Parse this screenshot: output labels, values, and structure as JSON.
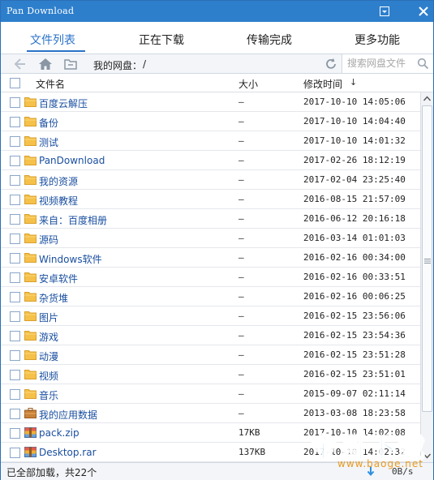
{
  "window": {
    "title": "Pan Download"
  },
  "tabs": [
    {
      "label": "文件列表",
      "active": true
    },
    {
      "label": "正在下载",
      "active": false
    },
    {
      "label": "传输完成",
      "active": false
    },
    {
      "label": "更多功能",
      "active": false
    }
  ],
  "toolbar": {
    "path_label": "我的网盘：",
    "path_value": "/",
    "search_placeholder": "搜索网盘文件"
  },
  "columns": {
    "name": "文件名",
    "size": "大小",
    "modified": "修改时间",
    "sort_indicator": "↓"
  },
  "files": [
    {
      "name": "百度云解压",
      "size": "–",
      "modified": "2017-10-10 14:05:06",
      "type": "folder"
    },
    {
      "name": "备份",
      "size": "–",
      "modified": "2017-10-10 14:04:40",
      "type": "folder"
    },
    {
      "name": "测试",
      "size": "–",
      "modified": "2017-10-10 14:01:32",
      "type": "folder"
    },
    {
      "name": "PanDownload",
      "size": "–",
      "modified": "2017-02-26 18:12:19",
      "type": "folder"
    },
    {
      "name": "我的资源",
      "size": "–",
      "modified": "2017-02-04 23:25:40",
      "type": "folder"
    },
    {
      "name": "视频教程",
      "size": "–",
      "modified": "2016-08-15 21:57:09",
      "type": "folder"
    },
    {
      "name": "来自：百度相册",
      "size": "–",
      "modified": "2016-06-12 20:16:18",
      "type": "folder"
    },
    {
      "name": "源码",
      "size": "–",
      "modified": "2016-03-14 01:01:03",
      "type": "folder"
    },
    {
      "name": "Windows软件",
      "size": "–",
      "modified": "2016-02-16 00:34:00",
      "type": "folder"
    },
    {
      "name": "安卓软件",
      "size": "–",
      "modified": "2016-02-16 00:33:51",
      "type": "folder"
    },
    {
      "name": "杂货堆",
      "size": "–",
      "modified": "2016-02-16 00:06:25",
      "type": "folder"
    },
    {
      "name": "图片",
      "size": "–",
      "modified": "2016-02-15 23:56:06",
      "type": "folder"
    },
    {
      "name": "游戏",
      "size": "–",
      "modified": "2016-02-15 23:54:36",
      "type": "folder"
    },
    {
      "name": "动漫",
      "size": "–",
      "modified": "2016-02-15 23:51:28",
      "type": "folder"
    },
    {
      "name": "视频",
      "size": "–",
      "modified": "2016-02-15 23:51:01",
      "type": "folder"
    },
    {
      "name": "音乐",
      "size": "–",
      "modified": "2015-09-07 02:11:14",
      "type": "folder"
    },
    {
      "name": "我的应用数据",
      "size": "–",
      "modified": "2013-03-08 18:23:58",
      "type": "app-folder"
    },
    {
      "name": "pack.zip",
      "size": "17KB",
      "modified": "2017-10-10 14:02:08",
      "type": "archive"
    },
    {
      "name": "Desktop.rar",
      "size": "137KB",
      "modified": "2017-10-10 14:02:32",
      "type": "archive"
    }
  ],
  "status": {
    "loaded_text": "已全部加载，共22个",
    "speed": "0B/s"
  },
  "watermark": {
    "text": "宝哥下载",
    "sub": "www.baoge.net"
  },
  "colors": {
    "titlebar": "#2d7fcc",
    "accent": "#2b73c8",
    "folder": "#f5c14a",
    "link": "#1a4fa0"
  },
  "icons": {
    "minimize": "minimize-icon",
    "close": "close-icon",
    "back": "back-arrow-icon",
    "home": "home-icon",
    "parent": "parent-folder-icon",
    "refresh": "refresh-icon",
    "search": "search-icon",
    "folder": "folder-icon",
    "archive": "archive-icon"
  }
}
